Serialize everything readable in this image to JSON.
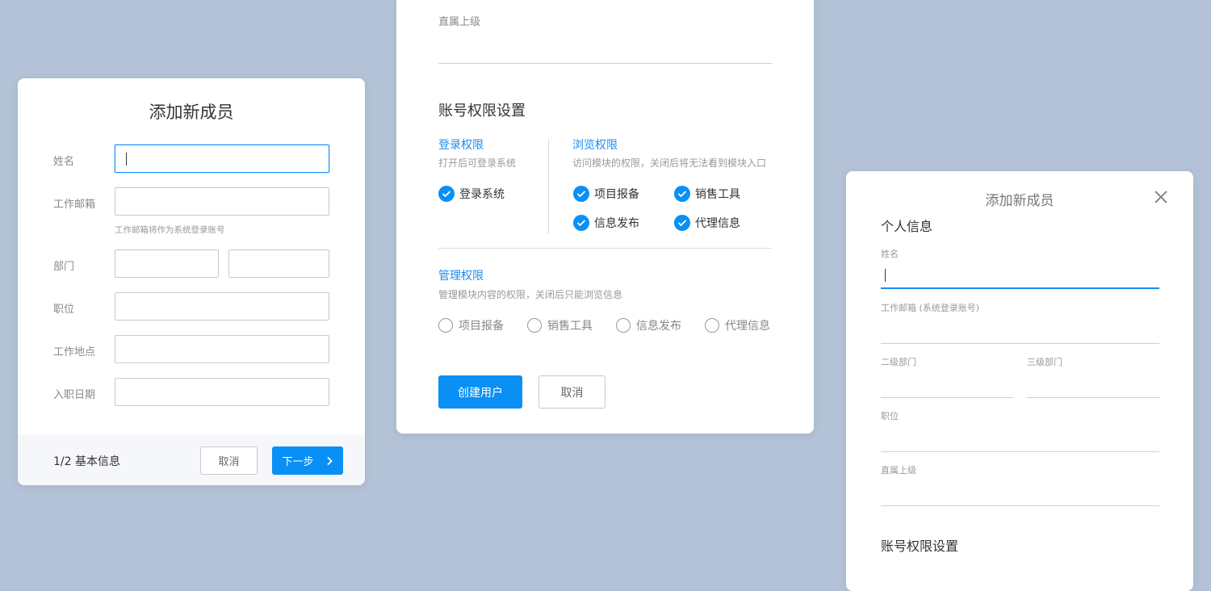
{
  "card1": {
    "title": "添加新成员",
    "labels": {
      "name": "姓名",
      "email": "工作邮箱",
      "department": "部门",
      "position": "职位",
      "location": "工作地点",
      "hire_date": "入职日期"
    },
    "email_hint": "工作邮箱将作为系统登录账号",
    "footer": {
      "step": "1/2 基本信息",
      "cancel_label": "取消",
      "next_label": "下一步"
    }
  },
  "card2": {
    "supervisor_label": "直属上级",
    "section_title": "账号权限设置",
    "login_perm": {
      "title": "登录权限",
      "desc": "打开后可登录系统",
      "option": "登录系统"
    },
    "browse_perm": {
      "title": "浏览权限",
      "desc": "访问模块的权限，关闭后将无法看到模块入口",
      "options": [
        "项目报备",
        "销售工具",
        "信息发布",
        "代理信息"
      ]
    },
    "manage_perm": {
      "title": "管理权限",
      "desc": "管理模块内容的权限，关闭后只能浏览信息",
      "options": [
        "项目报备",
        "销售工具",
        "信息发布",
        "代理信息"
      ]
    },
    "create_label": "创建用户",
    "cancel_label": "取消"
  },
  "card3": {
    "title": "添加新成员",
    "personal_info": "个人信息",
    "labels": {
      "name": "姓名",
      "email": "工作邮箱 (系统登录账号)",
      "dept2": "二级部门",
      "dept3": "三级部门",
      "position": "职位",
      "supervisor": "直属上级"
    },
    "section_title": "账号权限设置"
  },
  "colors": {
    "background": "#b3c2d6",
    "primary": "#0a90f5",
    "link_blue": "#1a8cf0"
  }
}
